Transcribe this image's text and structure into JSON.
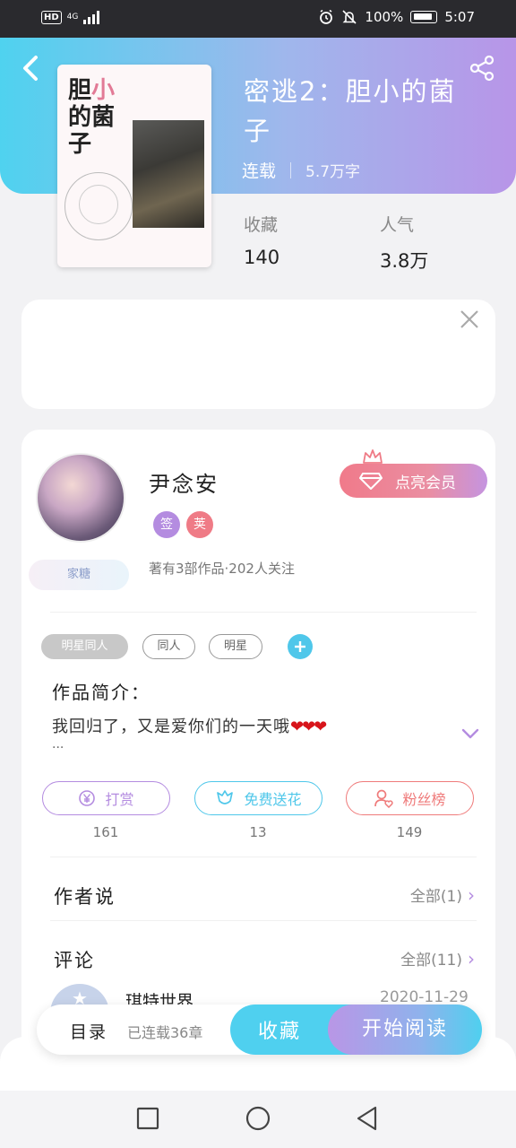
{
  "status_bar": {
    "network_label": "HD",
    "network_type": "4G",
    "battery": "100%",
    "time": "5:07"
  },
  "header": {
    "back_icon": "chevron-left-icon",
    "share_icon": "share-icon"
  },
  "book": {
    "title": "密逃2：胆小的菌子",
    "status": "连载",
    "word_count": "5.7万字",
    "cover": {
      "title_prefix": "胆",
      "title_accent": "小",
      "title_suffix": "的菌子"
    },
    "stats": [
      {
        "label": "收藏",
        "value": "140"
      },
      {
        "label": "人气",
        "value": "3.8万"
      }
    ]
  },
  "author": {
    "name": "尹念安",
    "badges": [
      {
        "text": "签",
        "color": "#b48ce0"
      },
      {
        "text": "荚",
        "color": "#ef7b86"
      }
    ],
    "avatar_badge": "家糖",
    "meta": "著有3部作品·202人关注",
    "vip_button": "点亮会员"
  },
  "tags": [
    "明星同人",
    "同人",
    "明星"
  ],
  "intro": {
    "title": "作品简介：",
    "text": "我回归了，又是爱你们的一天哦",
    "hearts": "❤❤❤",
    "ellipsis": "..."
  },
  "actions": [
    {
      "label": "打赏",
      "count": "161",
      "color": "#b48ce0",
      "icon": "yen-coin-icon"
    },
    {
      "label": "免费送花",
      "count": "13",
      "color": "#4fc7ea",
      "icon": "flower-icon"
    },
    {
      "label": "粉丝榜",
      "count": "149",
      "color": "#ef7b7b",
      "icon": "fan-user-icon"
    }
  ],
  "sections": {
    "author_says": {
      "title": "作者说",
      "more": "全部(1)"
    },
    "comments": {
      "title": "评论",
      "more": "全部(11)"
    }
  },
  "comment": {
    "user": "琪特世界",
    "date": "2020-11-29"
  },
  "bottom_bar": {
    "toc_label": "目录",
    "toc_sub": "已连载36章",
    "favorite": "收藏",
    "start_reading": "开始阅读"
  },
  "colors": {
    "accent_cyan": "#4fd0ef",
    "accent_purple": "#b48ce0",
    "accent_pink": "#ef7b86"
  }
}
